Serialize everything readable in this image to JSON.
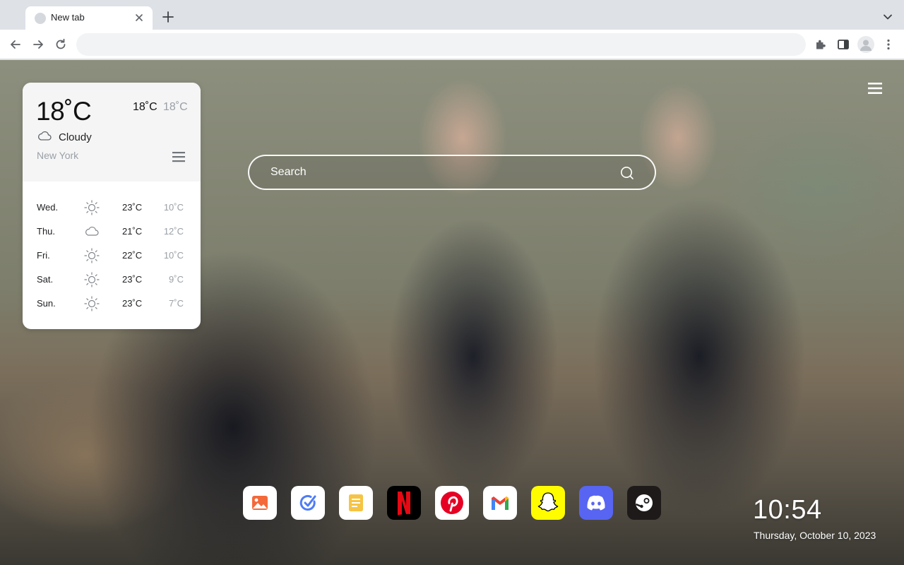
{
  "browser": {
    "tab": {
      "title": "New tab",
      "favicon": "globe-icon"
    },
    "new_tab_icon": "plus-icon",
    "tab_search_icon": "chevron-down-icon",
    "omnibox": {
      "value": "",
      "placeholder": ""
    },
    "toolbar_icons": [
      "back-icon",
      "forward-icon",
      "reload-icon",
      "extensions-icon",
      "side-panel-icon",
      "profile-icon",
      "more-icon"
    ]
  },
  "weather": {
    "current_temp": "18˚C",
    "high": "18˚C",
    "low": "18˚C",
    "condition": "Cloudy",
    "condition_icon": "cloud-icon",
    "city": "New York",
    "forecast": [
      {
        "day": "Wed.",
        "icon": "sun-icon",
        "high": "23˚C",
        "low": "10˚C"
      },
      {
        "day": "Thu.",
        "icon": "cloud-icon",
        "high": "21˚C",
        "low": "12˚C"
      },
      {
        "day": "Fri.",
        "icon": "sun-icon",
        "high": "22˚C",
        "low": "10˚C"
      },
      {
        "day": "Sat.",
        "icon": "sun-icon",
        "high": "23˚C",
        "low": "9˚C"
      },
      {
        "day": "Sun.",
        "icon": "sun-icon",
        "high": "23˚C",
        "low": "7˚C"
      }
    ]
  },
  "search": {
    "placeholder": "Search"
  },
  "dock": [
    {
      "name": "photos",
      "icon": "photos-icon"
    },
    {
      "name": "task",
      "icon": "check-circle-icon"
    },
    {
      "name": "notes",
      "icon": "notes-icon"
    },
    {
      "name": "netflix",
      "icon": "netflix-icon"
    },
    {
      "name": "pinterest",
      "icon": "pinterest-icon"
    },
    {
      "name": "gmail",
      "icon": "gmail-icon"
    },
    {
      "name": "snapchat",
      "icon": "snapchat-icon"
    },
    {
      "name": "discord",
      "icon": "discord-icon"
    },
    {
      "name": "steam",
      "icon": "steam-icon"
    }
  ],
  "clock": {
    "time": "10:54",
    "date": "Thursday, October 10, 2023"
  },
  "colors": {
    "chrome_bg": "#dee1e6",
    "netflix_red": "#e50914",
    "pinterest_red": "#e60023",
    "snapchat_yellow": "#fffc00",
    "discord_blurple": "#5865f2",
    "steam_dark": "#171a21"
  }
}
